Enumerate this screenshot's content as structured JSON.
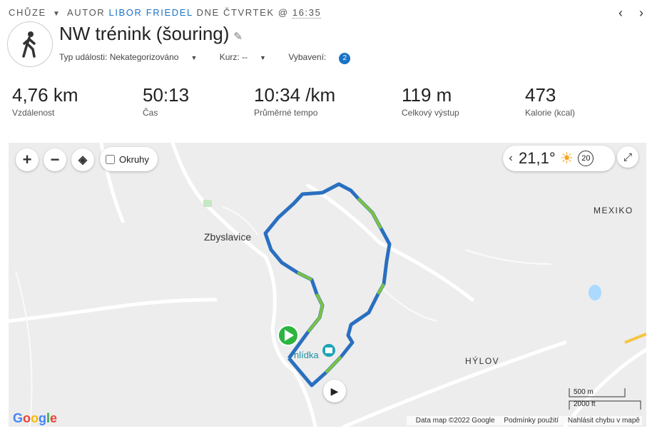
{
  "header": {
    "activity_type": "CHŮZE",
    "author_prefix": "AUTOR",
    "author": "LIBOR FRIEDEL",
    "day_prefix": "DNE ČTVRTEK @",
    "time": "16:35",
    "title": "NW trénink (šouring)",
    "event_type": "Typ události: Nekategorizováno",
    "course": "Kurz: --",
    "gear_label": "Vybavení:",
    "gear_count": "2"
  },
  "stats": [
    {
      "value": "4,76 km",
      "label": "Vzdálenost"
    },
    {
      "value": "50:13",
      "label": "Čas"
    },
    {
      "value": "10:34 /km",
      "label": "Průměrné tempo"
    },
    {
      "value": "119 m",
      "label": "Celkový výstup"
    },
    {
      "value": "473",
      "label": "Kalorie (kcal)"
    }
  ],
  "map": {
    "zoom_in": "+",
    "zoom_out": "−",
    "okruhy_label": "Okruhy",
    "temperature": "21,1°",
    "wind": "20",
    "places": {
      "town": "Zbyslavice",
      "mexiko": "MEXIKO",
      "hylov": "HÝLOV",
      "poi": "hlídka"
    },
    "scale_m": "500 m",
    "scale_ft": "2000 ft",
    "attribution": "Data map ©2022 Google",
    "terms": "Podmínky použití",
    "report": "Nahlásit chybu v mapě"
  }
}
